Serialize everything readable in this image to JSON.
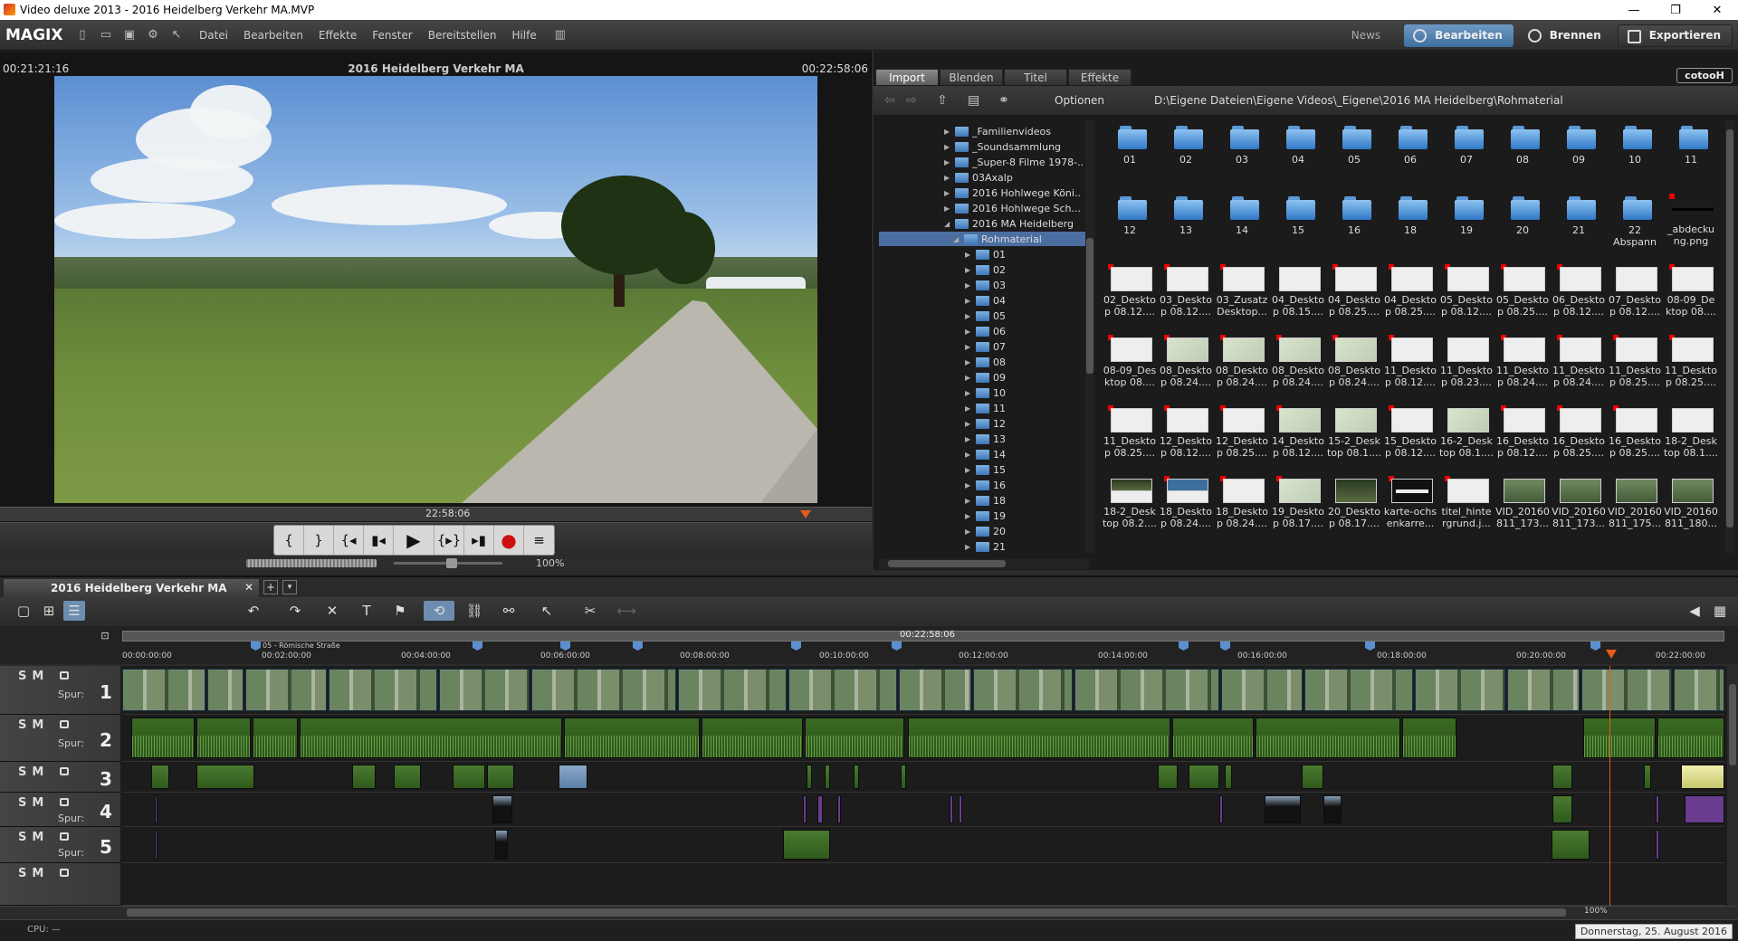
{
  "window": {
    "title": "Video deluxe 2013 - 2016 Heidelberg Verkehr MA.MVP",
    "minimize": "—",
    "maximize": "❐",
    "close": "✕"
  },
  "menubar": {
    "logo": "MAGIX",
    "items": [
      "Datei",
      "Bearbeiten",
      "Effekte",
      "Fenster",
      "Bereitstellen",
      "Hilfe"
    ],
    "news": "News",
    "modes": {
      "edit": "Bearbeiten",
      "burn": "Brennen",
      "export": "Exportieren"
    }
  },
  "preview": {
    "timecode_left": "00:21:21:16",
    "title": "2016 Heidelberg Verkehr MA",
    "timecode_right": "00:22:58:06",
    "scrub_timecode": "22:58:06",
    "zoom": "100%"
  },
  "transport": {
    "buttons": [
      "{",
      "}",
      "{◂",
      "▮◂",
      "▶",
      "{▸}",
      "▸▮",
      "●",
      "≡"
    ]
  },
  "pool": {
    "tabs": [
      "Import",
      "Blenden",
      "Titel",
      "Effekte"
    ],
    "brand": "cotooH",
    "options_label": "Optionen",
    "path": "D:\\Eigene Dateien\\Eigene Videos\\_Eigene\\2016 MA Heidelberg\\Rohmaterial",
    "tree": [
      {
        "label": "_Familienvideos"
      },
      {
        "label": "_Soundsammlung"
      },
      {
        "label": "_Super-8 Filme 1978-.."
      },
      {
        "label": "03Axalp"
      },
      {
        "label": "2016 Hohlwege Köni.."
      },
      {
        "label": "2016 Hohlwege Sch..."
      },
      {
        "label": "2016 MA Heidelberg"
      },
      {
        "label": "Rohmaterial"
      },
      {
        "label": "01"
      },
      {
        "label": "02"
      },
      {
        "label": "03"
      },
      {
        "label": "04"
      },
      {
        "label": "05"
      },
      {
        "label": "06"
      },
      {
        "label": "07"
      },
      {
        "label": "08"
      },
      {
        "label": "09"
      },
      {
        "label": "10"
      },
      {
        "label": "11"
      },
      {
        "label": "12"
      },
      {
        "label": "13"
      },
      {
        "label": "14"
      },
      {
        "label": "15"
      },
      {
        "label": "16"
      },
      {
        "label": "18"
      },
      {
        "label": "19"
      },
      {
        "label": "20"
      },
      {
        "label": "21"
      }
    ],
    "folders": [
      "01",
      "02",
      "03",
      "04",
      "05",
      "06",
      "07",
      "08",
      "09",
      "10",
      "11",
      "12",
      "13",
      "14",
      "15",
      "16",
      "18",
      "19",
      "20",
      "21"
    ],
    "folder22": [
      "22",
      "Abspann"
    ],
    "file_abdeck": [
      "_abdecku",
      "ng.png"
    ],
    "files": [
      [
        "02_Deskto",
        "p 08.12...."
      ],
      [
        "03_Deskto",
        "p 08.12...."
      ],
      [
        "03_Zusatz",
        "Desktop..."
      ],
      [
        "04_Deskto",
        "p 08.15...."
      ],
      [
        "04_Deskto",
        "p 08.25...."
      ],
      [
        "04_Deskto",
        "p 08.25...."
      ],
      [
        "05_Deskto",
        "p 08.12...."
      ],
      [
        "05_Deskto",
        "p 08.25...."
      ],
      [
        "06_Deskto",
        "p 08.12...."
      ],
      [
        "07_Deskto",
        "p 08.12...."
      ],
      [
        "08-09_De",
        "ktop 08...."
      ],
      [
        "08-09_Des",
        "ktop 08...."
      ],
      [
        "08_Deskto",
        "p 08.24...."
      ],
      [
        "08_Deskto",
        "p 08.24...."
      ],
      [
        "08_Deskto",
        "p 08.24...."
      ],
      [
        "08_Deskto",
        "p 08.24...."
      ],
      [
        "11_Deskto",
        "p 08.12...."
      ],
      [
        "11_Deskto",
        "p 08.23...."
      ],
      [
        "11_Deskto",
        "p 08.24...."
      ],
      [
        "11_Deskto",
        "p 08.24...."
      ],
      [
        "11_Deskto",
        "p 08.25...."
      ],
      [
        "11_Deskto",
        "p 08.25...."
      ],
      [
        "11_Deskto",
        "p 08.25...."
      ],
      [
        "12_Deskto",
        "p 08.12...."
      ],
      [
        "12_Deskto",
        "p 08.25...."
      ],
      [
        "14_Deskto",
        "p 08.12...."
      ],
      [
        "15-2_Desk",
        "top 08.1...."
      ],
      [
        "15_Deskto",
        "p 08.12...."
      ],
      [
        "16-2_Desk",
        "top 08.1...."
      ],
      [
        "16_Deskto",
        "p 08.12...."
      ],
      [
        "16_Deskto",
        "p 08.25...."
      ],
      [
        "16_Deskto",
        "p 08.25...."
      ],
      [
        "18-2_Desk",
        "top 08.1...."
      ],
      [
        "18-2_Desk",
        "top 08.2...."
      ],
      [
        "18_Deskto",
        "p 08.24...."
      ],
      [
        "18_Deskto",
        "p 08.24...."
      ],
      [
        "19_Deskto",
        "p 08.17...."
      ],
      [
        "20_Deskto",
        "p 08.17...."
      ],
      [
        "karte-ochs",
        "enkarre..."
      ],
      [
        "titel_hinte",
        "rgrund.j..."
      ],
      [
        "VID_20160",
        "811_173..."
      ],
      [
        "VID_20160",
        "811_173..."
      ],
      [
        "VID_20160",
        "811_175..."
      ],
      [
        "VID_20160",
        "811_180..."
      ]
    ]
  },
  "timeline": {
    "tab": "2016 Heidelberg Verkehr MA",
    "close": "✕",
    "add": "+",
    "dropdown": "▾",
    "ruler_timecode": "00:22:58:06",
    "marker_label": "05 - Römische Straße",
    "ticks": [
      "00:00:00:00",
      "00:02:00:00",
      "00:04:00:00",
      "00:06:00:00",
      "00:08:00:00",
      "00:10:00:00",
      "00:12:00:00",
      "00:14:00:00",
      "00:16:00:00",
      "00:18:00:00",
      "00:20:00:00",
      "00:22:00:00"
    ],
    "tracks": [
      {
        "smb": "SM",
        "spur": "Spur:",
        "num": "1"
      },
      {
        "smb": "SM",
        "spur": "Spur:",
        "num": "2"
      },
      {
        "smb": "SM",
        "spur": "",
        "num": "3"
      },
      {
        "smb": "SM",
        "spur": "Spur:",
        "num": "4"
      },
      {
        "smb": "SM",
        "spur": "Spur:",
        "num": "5"
      },
      {
        "smb": "SM",
        "spur": "",
        "num": ""
      }
    ],
    "zoom": "100%"
  },
  "status": {
    "cpu": "CPU: —",
    "date": "Donnerstag, 25. August 2016"
  }
}
